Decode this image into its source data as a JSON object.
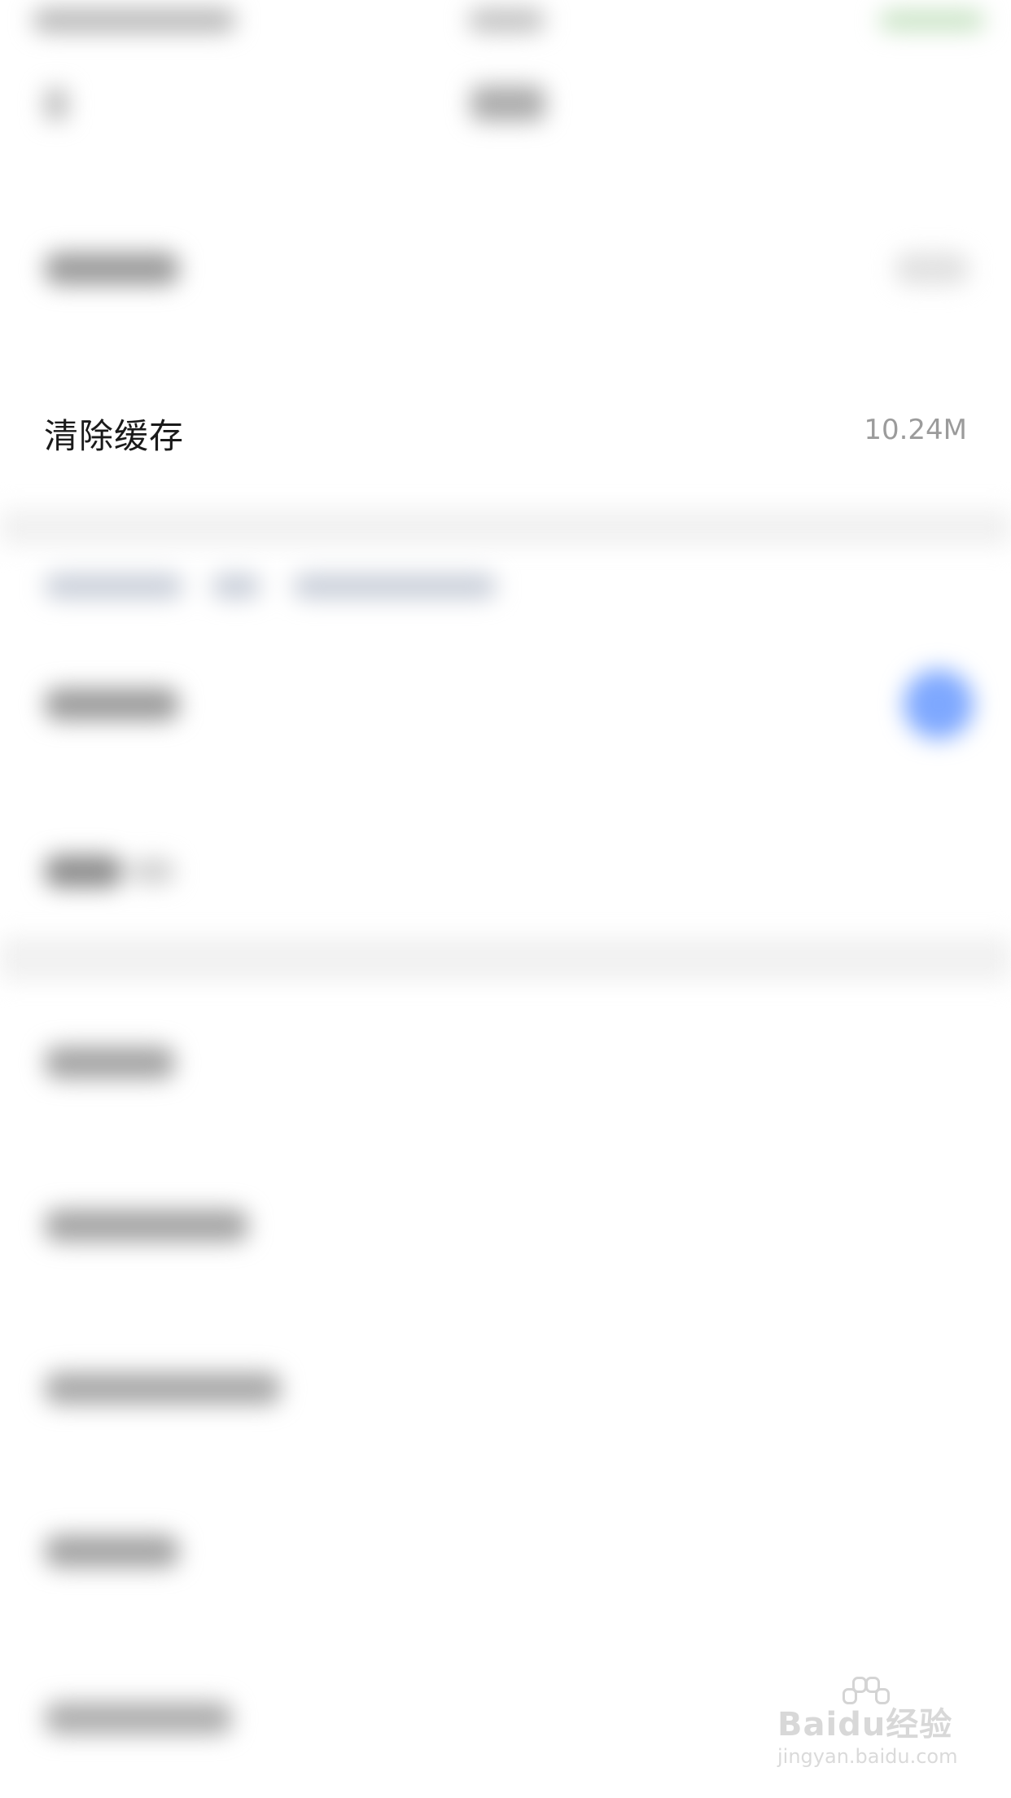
{
  "cache_row": {
    "label": "清除缓存",
    "value": "10.24M"
  },
  "watermark": {
    "logo_text": "Baidu经验",
    "url_text": "jingyan.baidu.com"
  },
  "colors": {
    "toggle_on": "#7ea8ff",
    "label": "#1a1a1a",
    "value": "#9b9b9b"
  },
  "icons": {
    "nav_back": "chevron-left-icon",
    "toggle": "toggle-switch-icon",
    "watermark": "paw-icon"
  }
}
